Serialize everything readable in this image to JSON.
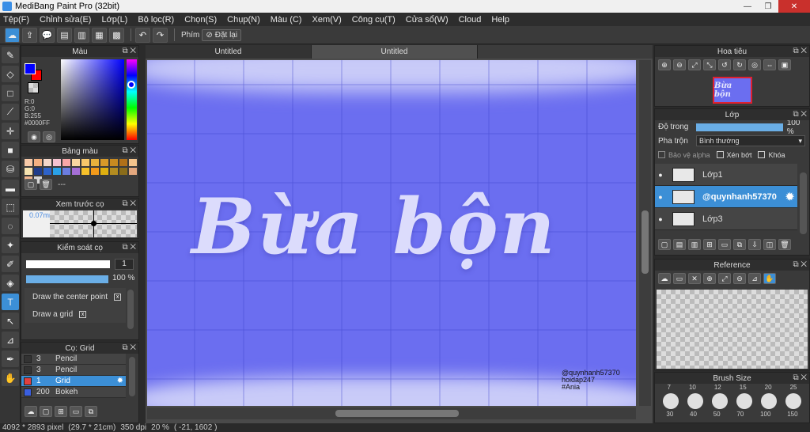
{
  "window": {
    "title": "MediBang Paint Pro (32bit)"
  },
  "menu": [
    "Tệp(F)",
    "Chỉnh sửa(E)",
    "Lớp(L)",
    "Bộ lọc(R)",
    "Chọn(S)",
    "Chụp(N)",
    "Màu (C)",
    "Xem(V)",
    "Công cụ(T)",
    "Cửa sổ(W)",
    "Cloud",
    "Help"
  ],
  "toolbar": {
    "key_label": "Phím",
    "reset_label": "Đặt lại"
  },
  "color_panel": {
    "title": "Màu",
    "r": "R:0",
    "g": "G:0",
    "b": "B:255",
    "hex": "#0000FF",
    "fg": "#0000FF",
    "bg": "#FF0000"
  },
  "palette_panel": {
    "title": "Bảng màu",
    "dash": "---",
    "swatches": [
      "#f7c9a8",
      "#f4b182",
      "#f2d6c9",
      "#f5c3d0",
      "#f9a7a7",
      "#f9d7a0",
      "#f7c76a",
      "#e9b13c",
      "#d89a28",
      "#c78a20",
      "#b07018",
      "#f4c48c",
      "#f6e2b0",
      "#1f3c8a",
      "#2e63c9",
      "#2aa1e8",
      "#6b7de0",
      "#a56fd6",
      "#f6c02a",
      "#f29a1a",
      "#e0b010",
      "#b48c20",
      "#8a6c1a",
      "#e3a77e",
      "#f0b48e",
      "#d6d6d6"
    ]
  },
  "brush_preview": {
    "title": "Xem trước cọ",
    "size": "0.07mm"
  },
  "brush_control": {
    "title": "Kiểm soát cọ",
    "size_value": "1",
    "opacity": "100 %",
    "opacity_fill": 1.0,
    "items": [
      {
        "label": "Draw the center point",
        "checked": "x"
      },
      {
        "label": "Draw a grid",
        "checked": "x"
      }
    ]
  },
  "brush_list": {
    "title": "Cọ: Grid",
    "items": [
      {
        "size": "3",
        "name": "Pencil",
        "color": "#333333"
      },
      {
        "size": "3",
        "name": "Pencil",
        "color": "#333333"
      },
      {
        "size": "1",
        "name": "Grid",
        "color": "#e04040"
      },
      {
        "size": "200",
        "name": "Bokeh",
        "color": "#3a5fe0"
      }
    ]
  },
  "tabs": [
    "Untitled",
    "Untitled"
  ],
  "canvas": {
    "title_text": "Bừa bộn",
    "watermark": [
      "@quynhanh57370",
      "hoidap247",
      "#Ania"
    ]
  },
  "navigator": {
    "title": "Hoa tiêu",
    "thumb_text": "Bừa bộn"
  },
  "layer_panel": {
    "title": "Lớp",
    "opacity_label": "Độ trong",
    "opacity_value": "100 %",
    "opacity_fill": 1.0,
    "blend_label": "Pha trộn",
    "blend_value": "Bình thường",
    "protect_alpha": "Bảo vệ alpha",
    "clip": "Xén bớt",
    "lock": "Khóa",
    "layers": [
      {
        "name": "Lớp1",
        "selected": false
      },
      {
        "name": "@quynhanh57370",
        "selected": true
      },
      {
        "name": "Lớp3",
        "selected": false
      }
    ]
  },
  "reference_panel": {
    "title": "Reference"
  },
  "brush_size_panel": {
    "title": "Brush Size",
    "top_labels": [
      "7",
      "10",
      "12",
      "15",
      "20",
      "25"
    ],
    "bottom_labels": [
      "30",
      "40",
      "50",
      "70",
      "100",
      "150"
    ]
  },
  "status": {
    "pixels": "4092 * 2893 pixel",
    "cm": "(29.7 * 21cm)",
    "dpi": "350 dpi",
    "zoom": "20 %",
    "coords": "( -21, 1602 )"
  }
}
